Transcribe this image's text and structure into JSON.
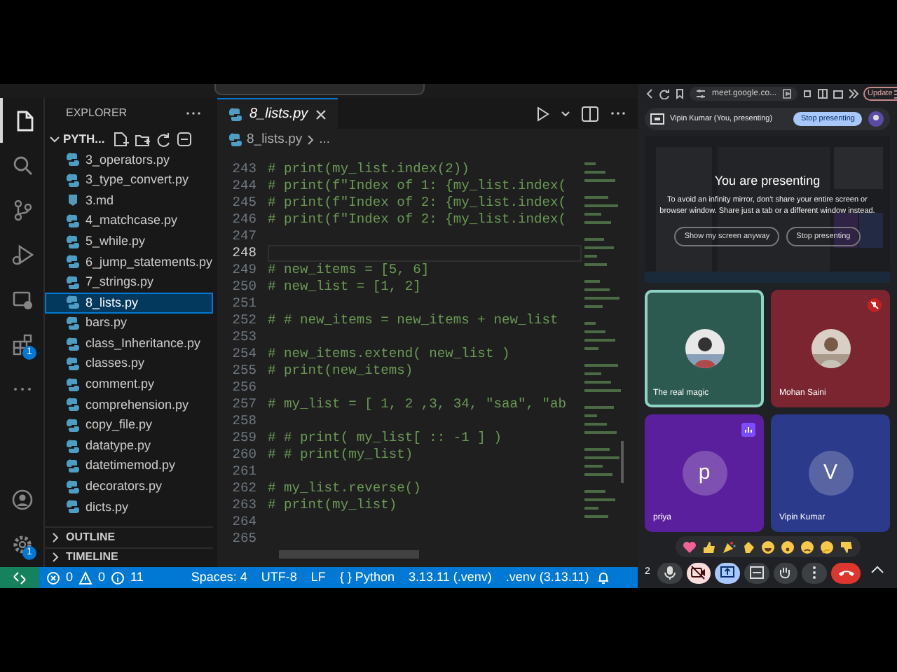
{
  "activity_bar": {
    "items": [
      {
        "kind": "explorer",
        "selected": true
      },
      {
        "kind": "search",
        "selected": false
      },
      {
        "kind": "source-control",
        "selected": false
      },
      {
        "kind": "run",
        "selected": false
      },
      {
        "kind": "remote",
        "selected": false
      },
      {
        "kind": "extensions",
        "selected": false,
        "badge": "1"
      },
      {
        "kind": "more",
        "selected": false
      }
    ],
    "bottom": [
      {
        "kind": "account"
      },
      {
        "kind": "settings",
        "badge": "1"
      }
    ]
  },
  "explorer": {
    "title": "EXPLORER",
    "folder": "PYTH...",
    "expanded": true,
    "files": [
      {
        "name": "3_operators.py",
        "kind": "python",
        "selected": false
      },
      {
        "name": "3_type_convert.py",
        "kind": "python",
        "selected": false
      },
      {
        "name": "3.md",
        "kind": "markdown",
        "selected": false
      },
      {
        "name": "4_matchcase.py",
        "kind": "python",
        "selected": false
      },
      {
        "name": "5_while.py",
        "kind": "python",
        "selected": false
      },
      {
        "name": "6_jump_statements.py",
        "kind": "python",
        "selected": false
      },
      {
        "name": "7_strings.py",
        "kind": "python",
        "selected": false
      },
      {
        "name": "8_lists.py",
        "kind": "python",
        "selected": true
      },
      {
        "name": "bars.py",
        "kind": "python",
        "selected": false
      },
      {
        "name": "class_Inheritance.py",
        "kind": "python",
        "selected": false
      },
      {
        "name": "classes.py",
        "kind": "python",
        "selected": false
      },
      {
        "name": "comment.py",
        "kind": "python",
        "selected": false
      },
      {
        "name": "comprehension.py",
        "kind": "python",
        "selected": false
      },
      {
        "name": "copy_file.py",
        "kind": "python",
        "selected": false
      },
      {
        "name": "datatype.py",
        "kind": "python",
        "selected": false
      },
      {
        "name": "datetimemod.py",
        "kind": "python",
        "selected": false
      },
      {
        "name": "decorators.py",
        "kind": "python",
        "selected": false
      },
      {
        "name": "dicts.py",
        "kind": "python",
        "selected": false
      }
    ],
    "sections": [
      {
        "label": "OUTLINE",
        "expanded": false
      },
      {
        "label": "TIMELINE",
        "expanded": false
      }
    ]
  },
  "editor": {
    "tab": {
      "label": "8_lists.py",
      "selected": true
    },
    "breadcrumb": [
      "8_lists.py",
      "..."
    ],
    "lines": [
      {
        "number": "243",
        "text": "# print(my_list.index(2))",
        "current": false
      },
      {
        "number": "244",
        "text": "# print(f\"Index of 1: {my_list.index(",
        "current": false
      },
      {
        "number": "245",
        "text": "# print(f\"Index of 2: {my_list.index(",
        "current": false
      },
      {
        "number": "246",
        "text": "# print(f\"Index of 2: {my_list.index(",
        "current": false
      },
      {
        "number": "247",
        "current": false
      },
      {
        "number": "248",
        "current": true
      },
      {
        "number": "249",
        "text": "# new_items = [5, 6]",
        "current": false
      },
      {
        "number": "250",
        "text": "# new_list = [1, 2]",
        "current": false
      },
      {
        "number": "251",
        "current": false
      },
      {
        "number": "252",
        "text": "# # new_items = new_items + new_list",
        "current": false
      },
      {
        "number": "253",
        "current": false
      },
      {
        "number": "254",
        "text": "# new_items.extend( new_list )",
        "current": false
      },
      {
        "number": "255",
        "text": "# print(new_items)",
        "current": false
      },
      {
        "number": "256",
        "current": false
      },
      {
        "number": "257",
        "text": "# my_list = [ 1, 2 ,3, 34, \"saa\", \"ab",
        "current": false
      },
      {
        "number": "258",
        "current": false
      },
      {
        "number": "259",
        "text": "# # print( my_list[ :: -1 ] )",
        "current": false
      },
      {
        "number": "260",
        "text": "# # print(my_list)",
        "current": false
      },
      {
        "number": "261",
        "current": false
      },
      {
        "number": "262",
        "text": "# my_list.reverse()",
        "current": false
      },
      {
        "number": "263",
        "text": "# print(my_list)",
        "current": false
      },
      {
        "number": "264",
        "current": false
      },
      {
        "number": "265",
        "current": false
      }
    ]
  },
  "status_bar": {
    "errors": "0",
    "warnings": "0",
    "info": "11",
    "items": [
      "Spaces: 4",
      "UTF-8",
      "LF",
      "{ } Python",
      "3.13.11 (.venv)",
      ".venv (3.13.11)"
    ]
  },
  "browser": {
    "url": "meet.google.co...",
    "update": "Update"
  },
  "meet": {
    "presenter_bar": {
      "text": "Vipin Kumar (You, presenting)",
      "button": "Stop presenting"
    },
    "overlay": {
      "title": "You are presenting",
      "message": "To avoid an infinity mirror, don't share your entire screen or browser window. Share just a tab or a different window instead.",
      "buttons": [
        "Show my screen anyway",
        "Stop presenting"
      ]
    },
    "tiles": [
      {
        "name": "The real magic",
        "color": "#2d5a50",
        "highlighted": true,
        "muted": false,
        "speaking": false
      },
      {
        "name": "Mohan Saini",
        "color": "#7a2530",
        "highlighted": false,
        "muted": true,
        "speaking": false
      },
      {
        "name": "priya",
        "avatar": {
          "kind": "letter",
          "letter": "p"
        },
        "color": "#5a1f9c",
        "highlighted": false,
        "muted": false,
        "speaking": true
      },
      {
        "name": "Vipin Kumar",
        "avatar": {
          "kind": "letter",
          "letter": "V"
        },
        "color": "#2b3a8a",
        "highlighted": false,
        "muted": false,
        "speaking": false
      }
    ],
    "reactions": [
      {
        "kind": "heart"
      },
      {
        "kind": "thumbs-up"
      },
      {
        "kind": "party"
      },
      {
        "kind": "clap"
      },
      {
        "kind": "laugh"
      },
      {
        "kind": "surprised"
      },
      {
        "kind": "sad"
      },
      {
        "kind": "thinking"
      },
      {
        "kind": "thumbs-down"
      }
    ],
    "participant_count": "2",
    "controls": [
      {
        "kind": "mic",
        "on": true
      },
      {
        "kind": "camera",
        "on": false
      },
      {
        "kind": "present",
        "on": true
      },
      {
        "kind": "panel",
        "on": false
      },
      {
        "kind": "hand",
        "on": false
      },
      {
        "kind": "more"
      },
      {
        "kind": "end"
      },
      {
        "kind": "caret"
      }
    ]
  }
}
